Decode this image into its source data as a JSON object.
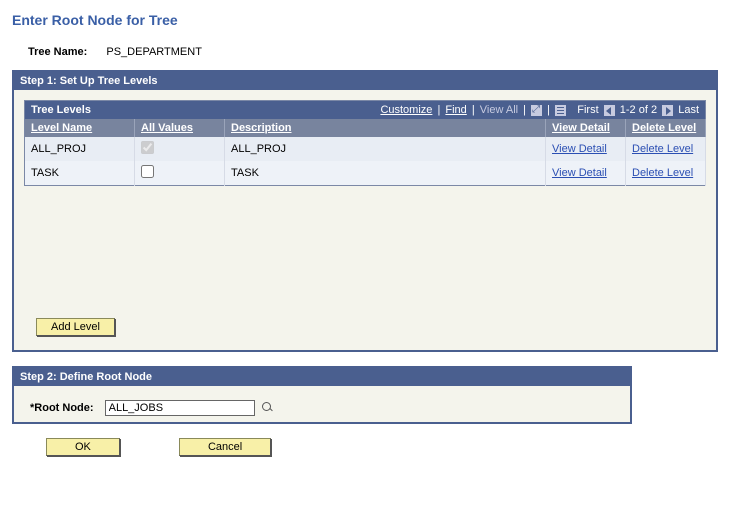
{
  "page": {
    "title": "Enter Root Node for Tree",
    "treeNameLabel": "Tree Name:",
    "treeNameValue": "PS_DEPARTMENT"
  },
  "step1": {
    "header": "Step 1: Set Up Tree Levels",
    "tableCaption": "Tree Levels",
    "toolbar": {
      "customize": "Customize",
      "find": "Find",
      "viewAll": "View All",
      "first": "First",
      "rangeText": "1-2 of 2",
      "last": "Last"
    },
    "columns": {
      "levelName": "Level Name",
      "allValues": "All Values",
      "description": "Description",
      "viewDetail": "View Detail",
      "deleteLevel": "Delete Level"
    },
    "rows": [
      {
        "levelName": "ALL_PROJ",
        "allValues": true,
        "allValuesDisabled": true,
        "description": "ALL_PROJ",
        "viewDetail": "View Detail",
        "deleteLevel": "Delete Level"
      },
      {
        "levelName": "TASK",
        "allValues": false,
        "allValuesDisabled": false,
        "description": "TASK",
        "viewDetail": "View Detail",
        "deleteLevel": "Delete Level"
      }
    ],
    "addLevel": "Add Level"
  },
  "step2": {
    "header": "Step 2: Define Root Node",
    "rootNodeLabel": "*Root Node:",
    "rootNodeValue": "ALL_JOBS"
  },
  "footer": {
    "ok": "OK",
    "cancel": "Cancel"
  }
}
